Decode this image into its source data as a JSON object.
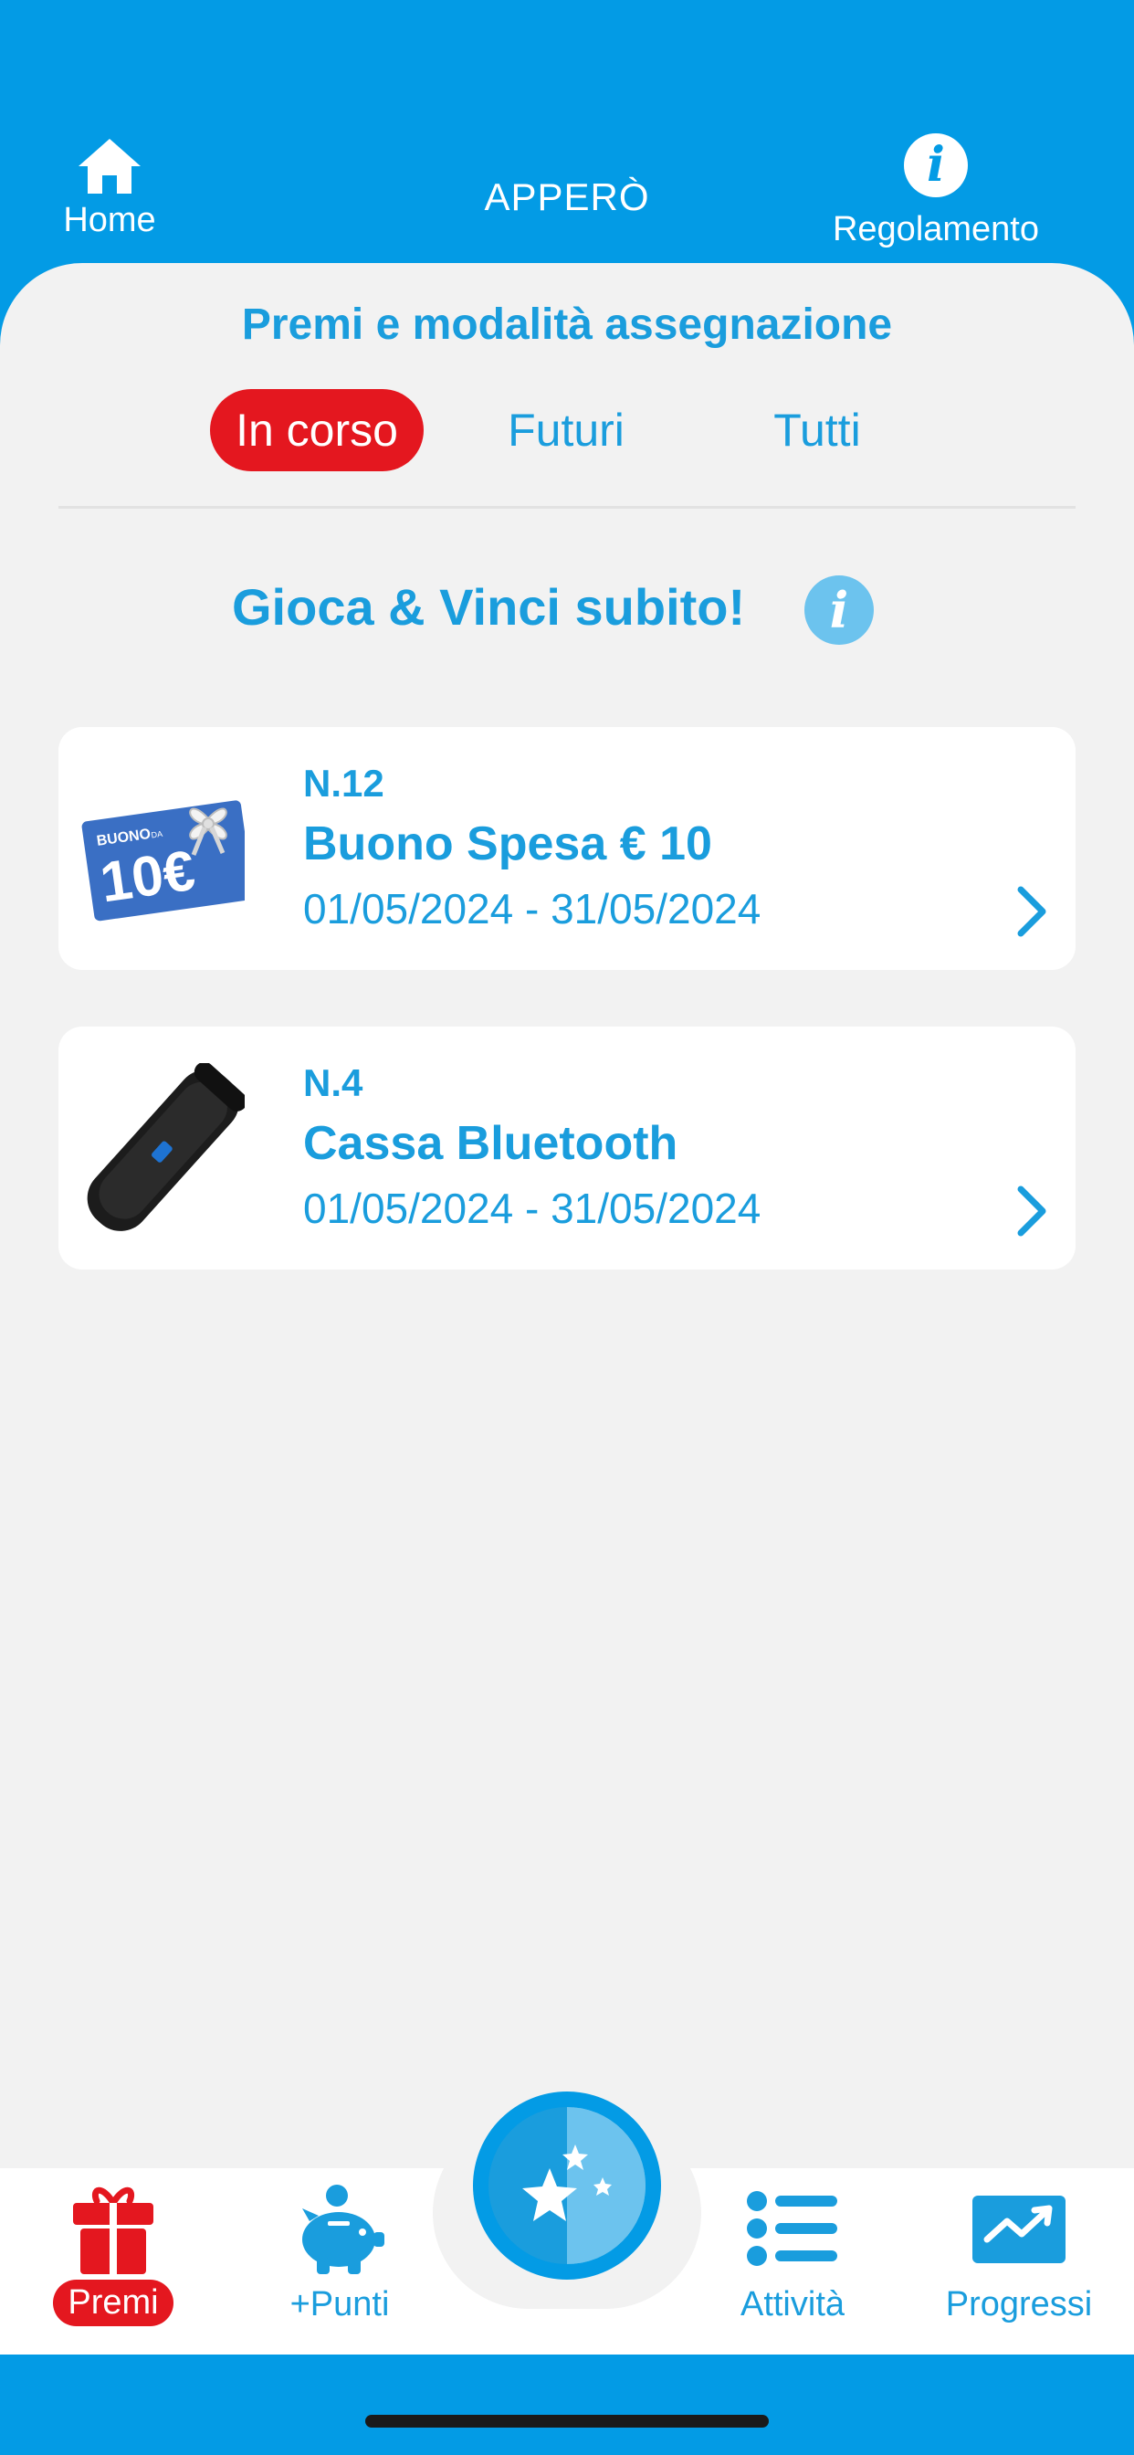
{
  "header": {
    "home_label": "Home",
    "app_title": "APPERÒ",
    "rules_label": "Regolamento",
    "rules_icon": "i"
  },
  "section": {
    "title": "Premi e modalità assegnazione",
    "tabs": [
      {
        "label": "In corso",
        "active": true
      },
      {
        "label": "Futuri",
        "active": false
      },
      {
        "label": "Tutti",
        "active": false
      }
    ]
  },
  "promo": {
    "title": "Gioca & Vinci subito!",
    "info_icon": "i"
  },
  "prizes": [
    {
      "quantity": "N.12",
      "name": "Buono Spesa € 10",
      "dates": "01/05/2024 - 31/05/2024",
      "image_text_top": "BUONO",
      "image_text_small": "DA",
      "image_text_value": "10€"
    },
    {
      "quantity": "N.4",
      "name": "Cassa Bluetooth",
      "dates": "01/05/2024 - 31/05/2024"
    }
  ],
  "bottom_nav": [
    {
      "label": "Premi",
      "icon": "gift-icon",
      "active": true
    },
    {
      "label": "+Punti",
      "icon": "piggy-bank-icon",
      "active": false
    },
    {
      "label": "",
      "icon": "stars-icon",
      "active": false
    },
    {
      "label": "Attività",
      "icon": "list-icon",
      "active": false
    },
    {
      "label": "Progressi",
      "icon": "trend-chart-icon",
      "active": false
    }
  ],
  "colors": {
    "brand_blue": "#039be5",
    "text_blue": "#1a9ddd",
    "accent_red": "#e4171f",
    "background": "#f2f2f2"
  }
}
